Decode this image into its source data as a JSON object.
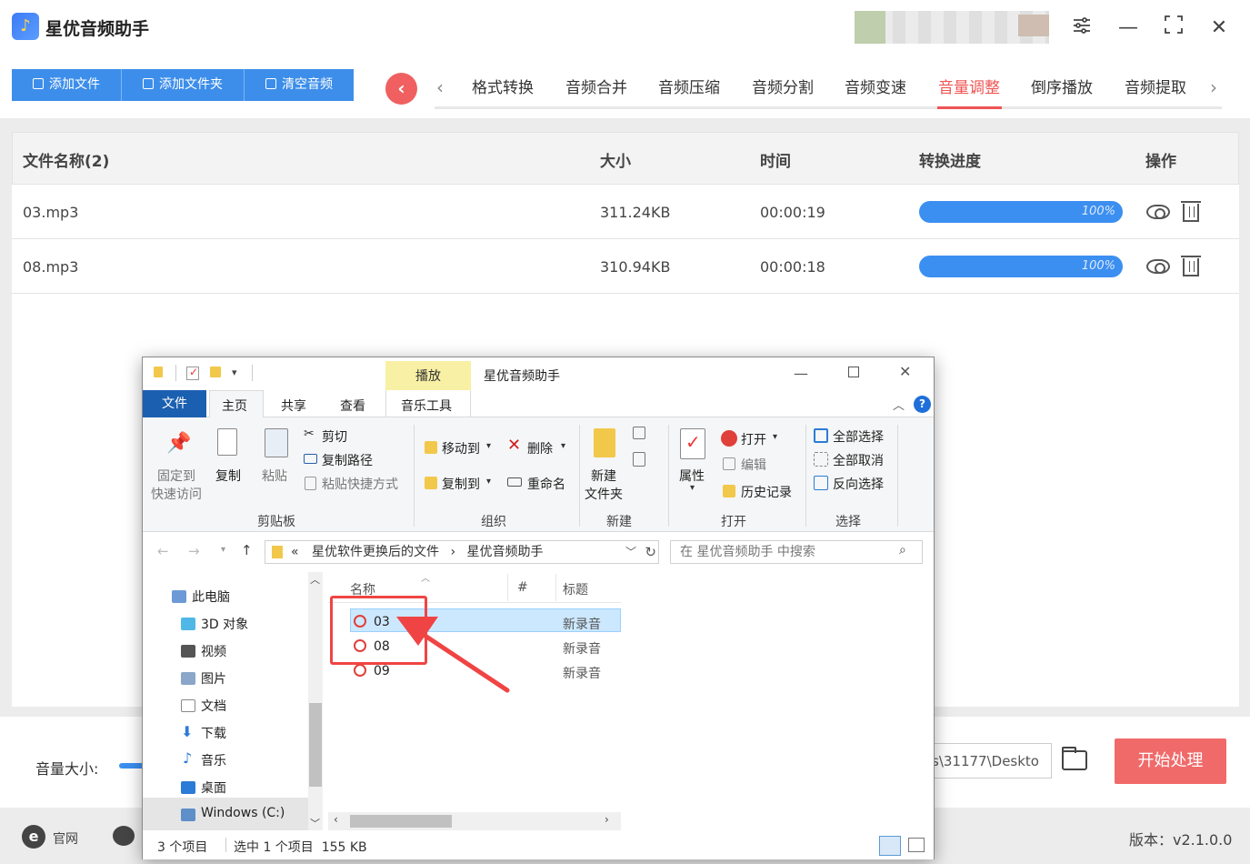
{
  "app": {
    "title": "星优音频助手"
  },
  "toolbar": {
    "add_file": "添加文件",
    "add_folder": "添加文件夹",
    "clear": "清空音频"
  },
  "tabs": [
    "格式转换",
    "音频合并",
    "音频压缩",
    "音频分割",
    "音频变速",
    "音量调整",
    "倒序播放",
    "音频提取"
  ],
  "active_tab": "音量调整",
  "table": {
    "headers": {
      "name": "文件名称(2)",
      "size": "大小",
      "time": "时间",
      "progress": "转换进度",
      "ops": "操作"
    },
    "rows": [
      {
        "name": "03.mp3",
        "size": "311.24KB",
        "time": "00:00:19",
        "progress": "100%"
      },
      {
        "name": "08.mp3",
        "size": "310.94KB",
        "time": "00:00:18",
        "progress": "100%"
      }
    ]
  },
  "bottom": {
    "volume_label": "音量大小:",
    "output_path": "s\\31177\\Deskto",
    "start_label": "开始处理"
  },
  "footer": {
    "website": "官网",
    "version": "版本：v2.1.0.0"
  },
  "explorer": {
    "title": "星优音频助手",
    "context_tab": "播放",
    "ribbon_tabs": {
      "file": "文件",
      "main": "主页",
      "share": "共享",
      "view": "查看",
      "music": "音乐工具"
    },
    "clipboard": {
      "pin": "固定到",
      "pin2": "快速访问",
      "copy": "复制",
      "paste": "粘贴",
      "cut": "剪切",
      "copy_path": "复制路径",
      "paste_shortcut": "粘贴快捷方式",
      "group": "剪贴板"
    },
    "organize": {
      "move_to": "移动到",
      "copy_to": "复制到",
      "delete": "删除",
      "rename": "重命名",
      "group": "组织"
    },
    "new": {
      "new_folder": "新建",
      "new_folder2": "文件夹",
      "group": "新建"
    },
    "open": {
      "properties": "属性",
      "open": "打开",
      "edit": "编辑",
      "history": "历史记录",
      "group": "打开"
    },
    "select": {
      "all": "全部选择",
      "none": "全部取消",
      "invert": "反向选择",
      "group": "选择"
    },
    "address": {
      "prefix": "«",
      "part1": "星优软件更换后的文件",
      "sep": "›",
      "part2": "星优音频助手"
    },
    "search_placeholder": "在 星优音频助手 中搜索",
    "nav": [
      "此电脑",
      "3D 对象",
      "视频",
      "图片",
      "文档",
      "下载",
      "音乐",
      "桌面",
      "Windows (C:)"
    ],
    "list_headers": {
      "name": "名称",
      "num": "#",
      "title": "标题"
    },
    "files": [
      {
        "name": "03",
        "title": "新录音"
      },
      {
        "name": "08",
        "title": "新录音"
      },
      {
        "name": "09",
        "title": "新录音"
      }
    ],
    "status": {
      "count": "3 个项目",
      "selected": "选中 1 个项目  155 KB"
    }
  }
}
